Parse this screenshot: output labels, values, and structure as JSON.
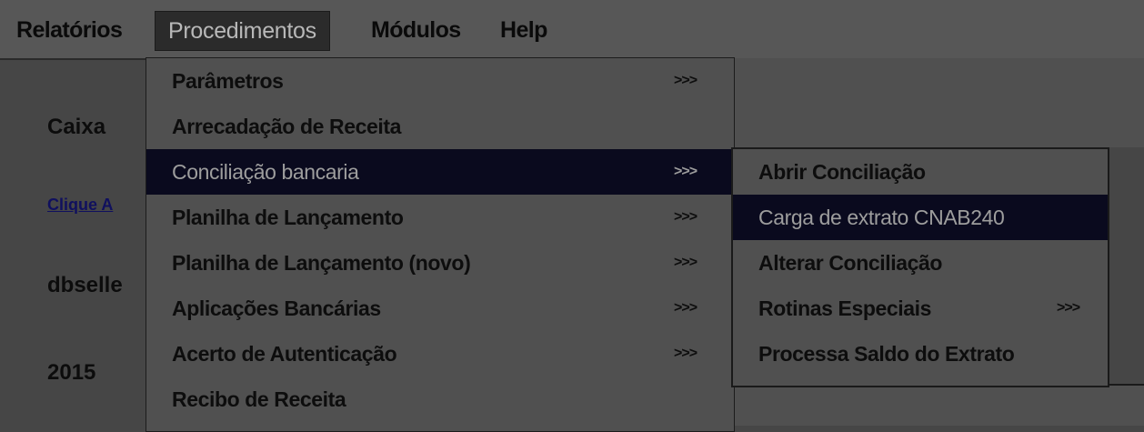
{
  "menubar": {
    "items": [
      {
        "label": "Relatórios"
      },
      {
        "label": "Procedimentos"
      },
      {
        "label": "Módulos"
      },
      {
        "label": "Help"
      }
    ]
  },
  "background": {
    "caixa": "Caixa",
    "link": "Clique A",
    "user": "dbselle",
    "year": "2015"
  },
  "procedimentos_menu": {
    "items": [
      {
        "label": "Parâmetros",
        "arrow": ">>>"
      },
      {
        "label": "Arrecadação de Receita",
        "arrow": ""
      },
      {
        "label": "Conciliação bancaria",
        "arrow": ">>>"
      },
      {
        "label": "Planilha de Lançamento",
        "arrow": ">>>"
      },
      {
        "label": "Planilha de Lançamento (novo)",
        "arrow": ">>>"
      },
      {
        "label": "Aplicações Bancárias",
        "arrow": ">>>"
      },
      {
        "label": "Acerto de Autenticação",
        "arrow": ">>>"
      },
      {
        "label": "Recibo de Receita",
        "arrow": ""
      }
    ],
    "highlighted_index": 2
  },
  "conciliacao_submenu": {
    "items": [
      {
        "label": "Abrir Conciliação",
        "arrow": ""
      },
      {
        "label": "Carga de extrato CNAB240",
        "arrow": ""
      },
      {
        "label": "Alterar Conciliação",
        "arrow": ""
      },
      {
        "label": "Rotinas Especiais",
        "arrow": ">>>"
      },
      {
        "label": "Processa Saldo do Extrato",
        "arrow": ""
      }
    ],
    "highlighted_index": 1
  }
}
